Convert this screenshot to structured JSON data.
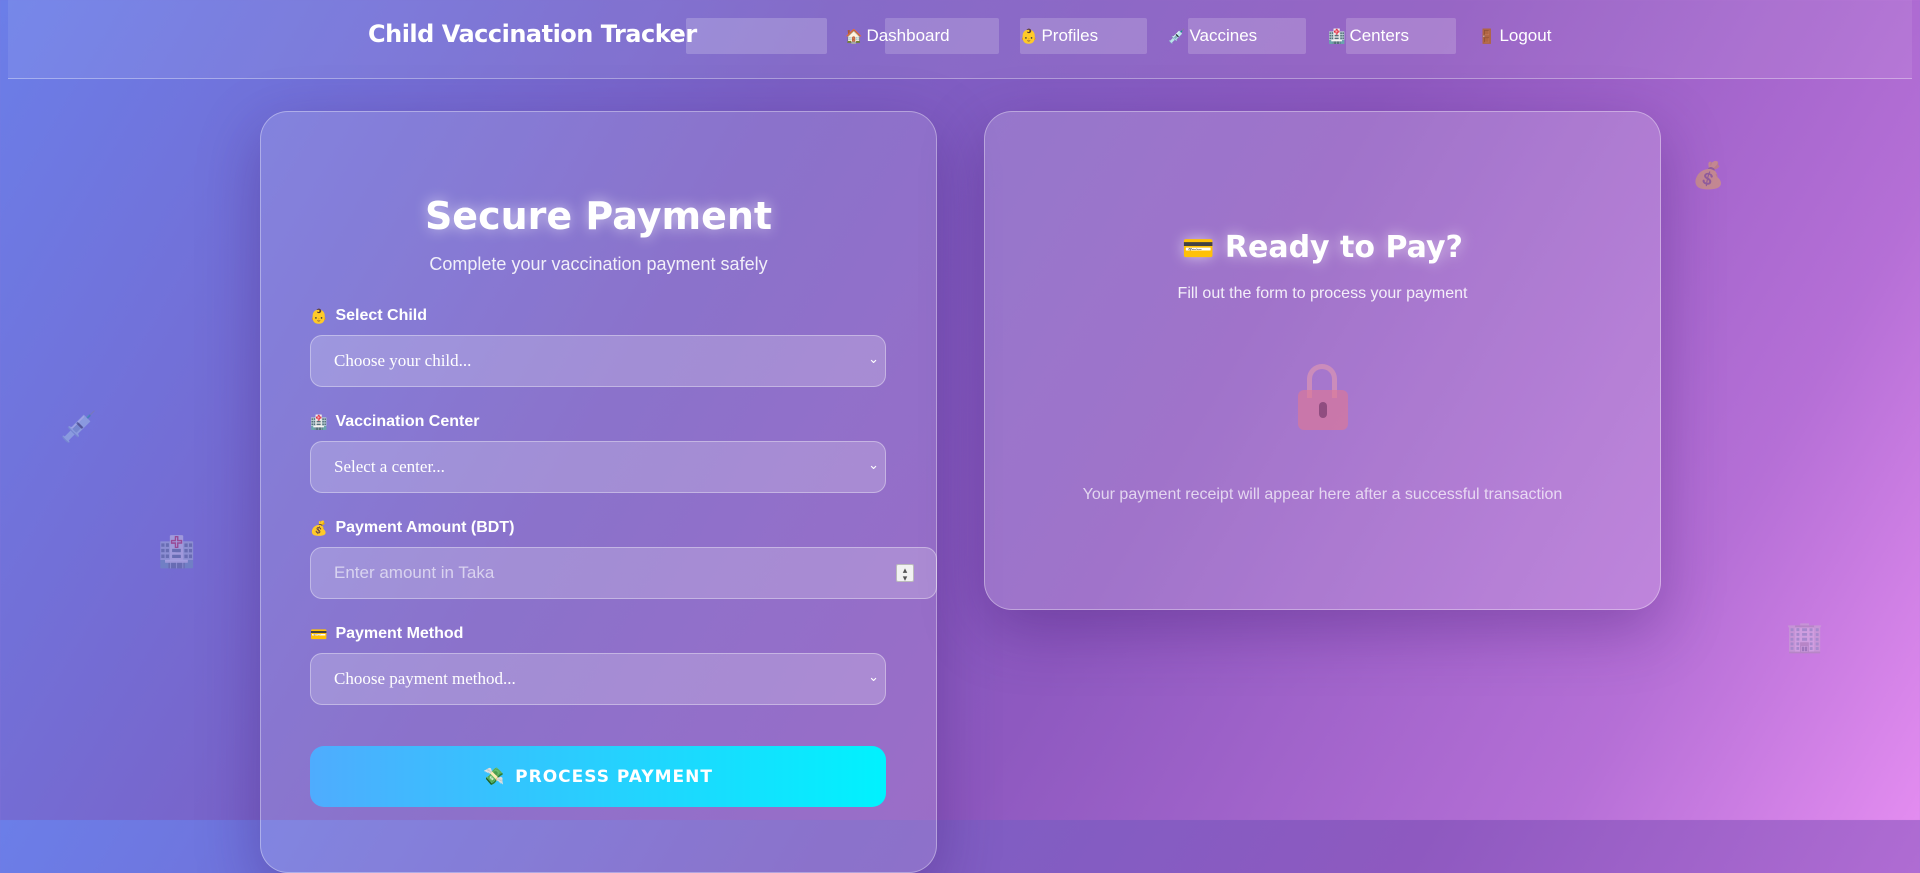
{
  "header": {
    "brand": "Child Vaccination Tracker",
    "nav": [
      {
        "icon": "🏠",
        "label": "Dashboard"
      },
      {
        "icon": "👶",
        "label": "Profiles"
      },
      {
        "icon": "💉",
        "label": "Vaccines"
      },
      {
        "icon": "🏥",
        "label": "Centers"
      },
      {
        "icon": "🚪",
        "label": "Logout"
      }
    ]
  },
  "payment": {
    "title": "Secure Payment",
    "subtitle": "Complete your vaccination payment safely",
    "fields": {
      "child": {
        "icon": "👶",
        "label": "Select Child",
        "value": "Choose your child..."
      },
      "center": {
        "icon": "🏥",
        "label": "Vaccination Center",
        "value": "Select a center..."
      },
      "amount": {
        "icon": "💰",
        "label": "Payment Amount (BDT)",
        "placeholder": "Enter amount in Taka"
      },
      "method": {
        "icon": "💳",
        "label": "Payment Method",
        "value": "Choose payment method..."
      }
    },
    "submit": {
      "icon": "💸",
      "label": "PROCESS PAYMENT"
    }
  },
  "receipt": {
    "icon": "💳",
    "title": "Ready to Pay?",
    "subtitle": "Fill out the form to process your payment",
    "note": "Your payment receipt will appear here after a successful transaction"
  },
  "decor": {
    "icons": [
      "💉",
      "🏥",
      "💰",
      "🏢"
    ]
  }
}
